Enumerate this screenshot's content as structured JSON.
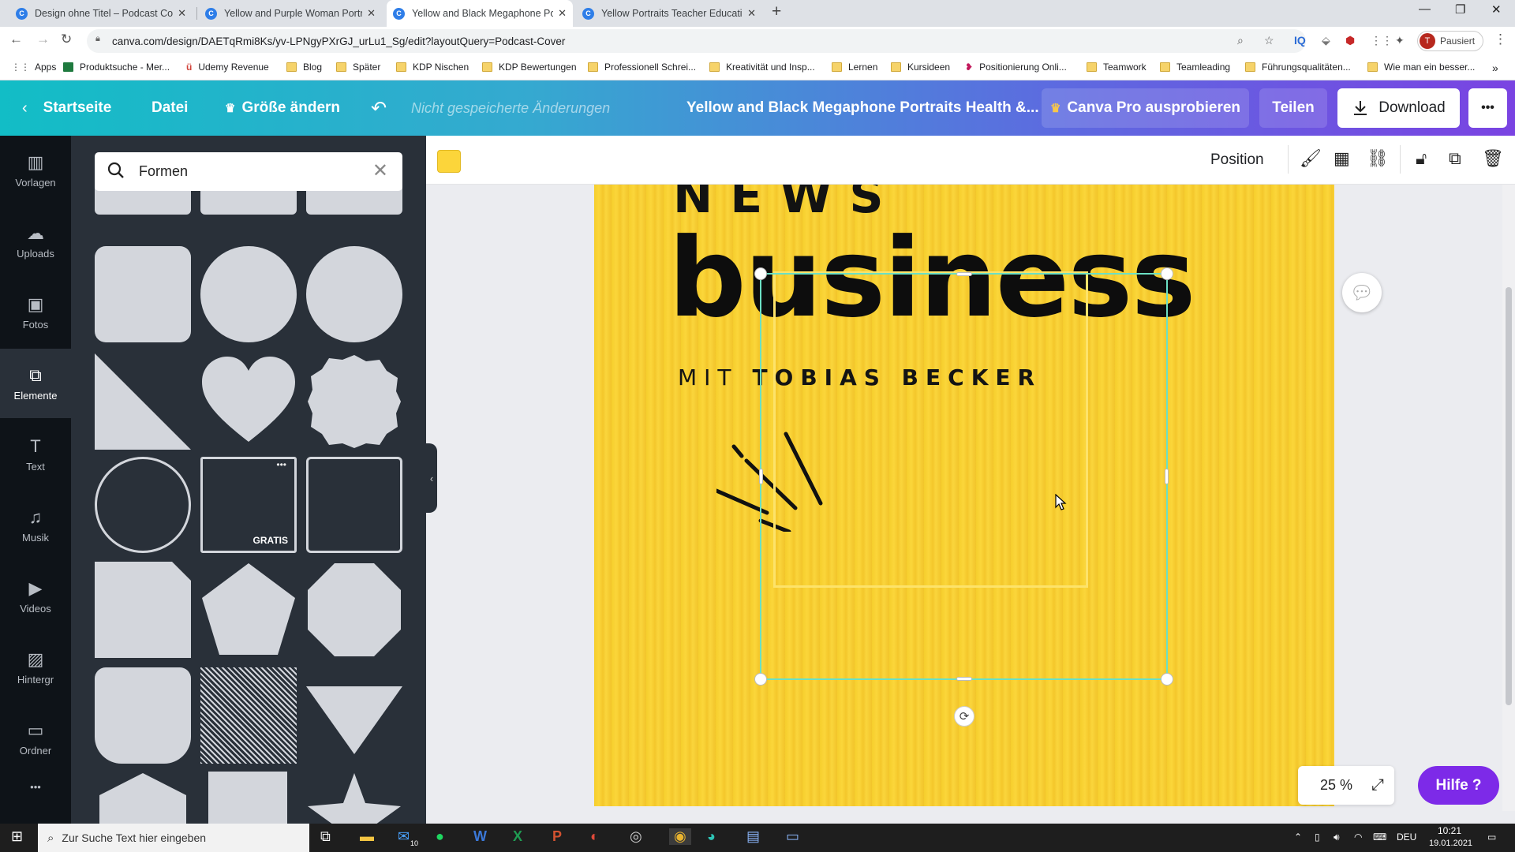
{
  "browser": {
    "tabs": [
      {
        "title": "Design ohne Titel – Podcast Cove",
        "active": false
      },
      {
        "title": "Yellow and Purple Woman Portra",
        "active": false
      },
      {
        "title": "Yellow and Black Megaphone Po",
        "active": true
      },
      {
        "title": "Yellow Portraits Teacher Educatio",
        "active": false
      }
    ],
    "url": "canva.com/design/DAETqRmi8Ks/yv-LPNgyPXrGJ_urLu1_Sg/edit?layoutQuery=Podcast-Cover",
    "profile_initial": "T",
    "profile_label": "Pausiert",
    "bookmarks": [
      "Apps",
      "Produktsuche - Mer...",
      "Udemy Revenue",
      "Blog",
      "Später",
      "KDP Nischen",
      "KDP Bewertungen",
      "Professionell Schrei...",
      "Kreativität und Insp...",
      "Lernen",
      "Kursideen",
      "Positionierung Onli...",
      "Teamwork",
      "Teamleading",
      "Führungsqualitäten...",
      "Wie man ein besser..."
    ]
  },
  "header": {
    "home": "Startseite",
    "file": "Datei",
    "resize": "Größe ändern",
    "unsaved": "Nicht gespeicherte Änderungen",
    "title": "Yellow and Black Megaphone Portraits Health &...",
    "pro": "Canva Pro ausprobieren",
    "share": "Teilen",
    "download": "Download",
    "more": "•••"
  },
  "rail": [
    {
      "label": "Vorlagen",
      "icon": "template-icon"
    },
    {
      "label": "Uploads",
      "icon": "cloud-upload-icon"
    },
    {
      "label": "Fotos",
      "icon": "photo-icon"
    },
    {
      "label": "Elemente",
      "icon": "shapes-icon"
    },
    {
      "label": "Text",
      "icon": "text-icon"
    },
    {
      "label": "Musik",
      "icon": "music-icon"
    },
    {
      "label": "Videos",
      "icon": "video-icon"
    },
    {
      "label": "Hintergr",
      "icon": "background-icon"
    },
    {
      "label": "Ordner",
      "icon": "folder-icon"
    }
  ],
  "rail_more": "•••",
  "panel": {
    "search_value": "Formen",
    "free_badge": "GRATIS",
    "more_dots": "•••"
  },
  "toolbar": {
    "color": "#fcd53a",
    "position": "Position"
  },
  "design": {
    "news": "NEWS",
    "business": "business",
    "subtitle_pre": "MIT",
    "subtitle_name": "TOBIAS BECKER"
  },
  "zoom": "25 %",
  "help": "Hilfe ?",
  "taskbar": {
    "search_placeholder": "Zur Suche Text hier eingeben",
    "lang": "DEU",
    "time": "10:21",
    "date": "19.01.2021",
    "mail_badge": "10"
  }
}
